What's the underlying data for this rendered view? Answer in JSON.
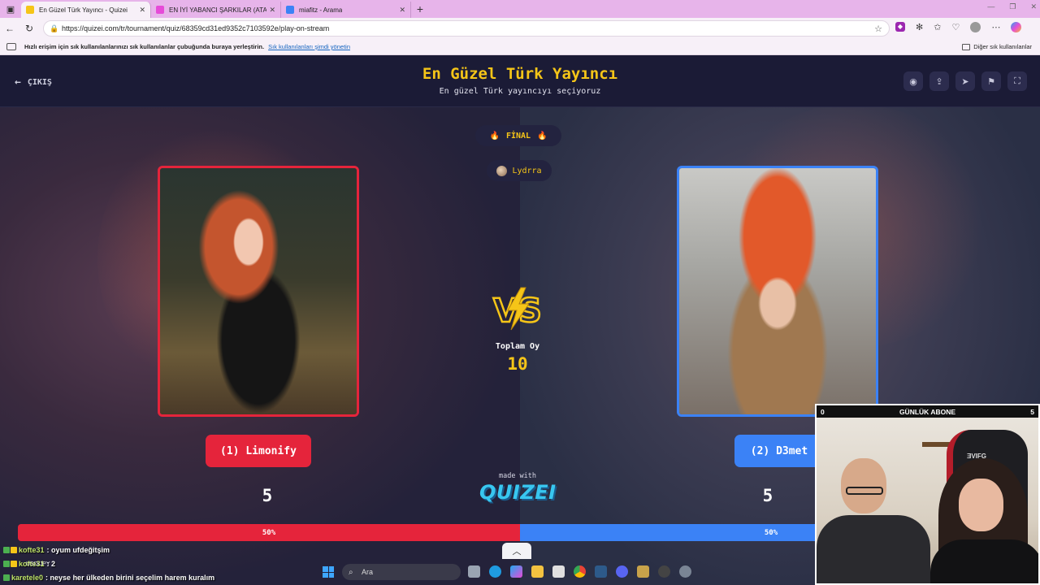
{
  "browser": {
    "tabs": [
      {
        "title": "En Güzel Türk Yayıncı - Quizei",
        "favicon_color": "#f5c518",
        "active": true
      },
      {
        "title": "EN İYİ YABANCI ŞARKILAR (ATADI",
        "favicon_color": "#e64bd8",
        "active": false
      },
      {
        "title": "miafitz - Arama",
        "favicon_color": "#3b82f6",
        "active": false
      }
    ],
    "url": "https://quizei.com/tr/tournament/quiz/68359cd31ed9352c7103592e/play-on-stream",
    "favorites_message": "Hızlı erişim için sık kullanılanlarınızı sık kullanılanlar çubuğunda buraya yerleştirin.",
    "favorites_link": "Sık kullanılanları şimdi yönetin",
    "other_favorites": "Diğer sık kullanılanlar"
  },
  "header": {
    "exit_label": "ÇIKIŞ",
    "title": "En Güzel Türk Yayıncı",
    "subtitle": "En güzel Türk yayıncıyı seçiyoruz",
    "icons": [
      "eye-icon",
      "share-icon",
      "send-icon",
      "flag-icon",
      "fullscreen-icon"
    ]
  },
  "match": {
    "round_label": "FİNAL",
    "creator": "Lydrra",
    "left": {
      "name": "(1) Limonify",
      "score": "5",
      "percent_label": "50%",
      "percent": 50
    },
    "right": {
      "name": "(2) D3met",
      "score": "5",
      "percent_label": "50%",
      "percent": 50
    },
    "total_label": "Toplam Oy",
    "total_value": "10",
    "accent_left": "#e5243b",
    "accent_right": "#3b82f6",
    "accent_gold": "#f5c518"
  },
  "branding": {
    "made_with": "made with",
    "logo_text": "QUIZEI"
  },
  "webcam": {
    "left_count": "0",
    "title": "GÜNLÜK ABONE",
    "right_count": "5",
    "chair_brand": "ƎVIFG"
  },
  "chat": [
    {
      "user": "kofte31",
      "message": ": oyum ufdeğitşim"
    },
    {
      "user": "kofte31",
      "message": ": 2"
    },
    {
      "user": "karetele0",
      "message": ": neyse her ülkeden birini seçelim harem kuralım"
    }
  ],
  "taskbar": {
    "search_placeholder": "Ara",
    "ticker": "USD/JPY"
  }
}
